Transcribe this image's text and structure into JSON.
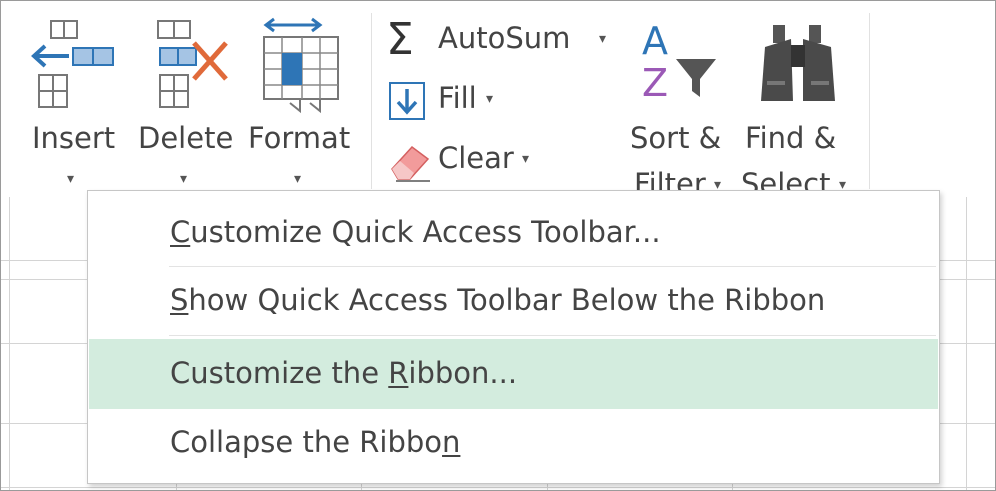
{
  "ribbon": {
    "cells": {
      "insert": {
        "label": "Insert",
        "arrow": "▾"
      },
      "delete": {
        "label": "Delete",
        "arrow": "▾"
      },
      "format": {
        "label": "Format",
        "arrow": "▾"
      }
    },
    "editing": {
      "autosum": {
        "label": "AutoSum",
        "arrow": "▾",
        "symbol": "Σ"
      },
      "fill": {
        "label": "Fill",
        "arrow": "▾"
      },
      "clear": {
        "label": "Clear",
        "arrow": "▾"
      },
      "sort_filter": {
        "line1": "Sort &",
        "line2": "Filter",
        "arrow": "▾",
        "az_a": "A",
        "az_z": "Z"
      },
      "find_select": {
        "line1": "Find &",
        "line2": "Select",
        "arrow": "▾"
      }
    }
  },
  "context_menu": {
    "items": [
      {
        "pre": "",
        "key": "C",
        "post": "ustomize Quick Access Toolbar..."
      },
      {
        "pre": "",
        "key": "S",
        "post": "how Quick Access Toolbar Below the Ribbon"
      },
      {
        "pre": "Customize the ",
        "key": "R",
        "post": "ibbon...",
        "highlighted": true
      },
      {
        "pre": "Collapse the Ribbo",
        "key": "n",
        "post": ""
      }
    ]
  },
  "colors": {
    "highlight": "#d3ecde",
    "icon_blue": "#2e75b6",
    "delete_x": "#e06a3a",
    "sort_a": "#2e75b6",
    "sort_z": "#9b59b6",
    "text": "#444444"
  }
}
